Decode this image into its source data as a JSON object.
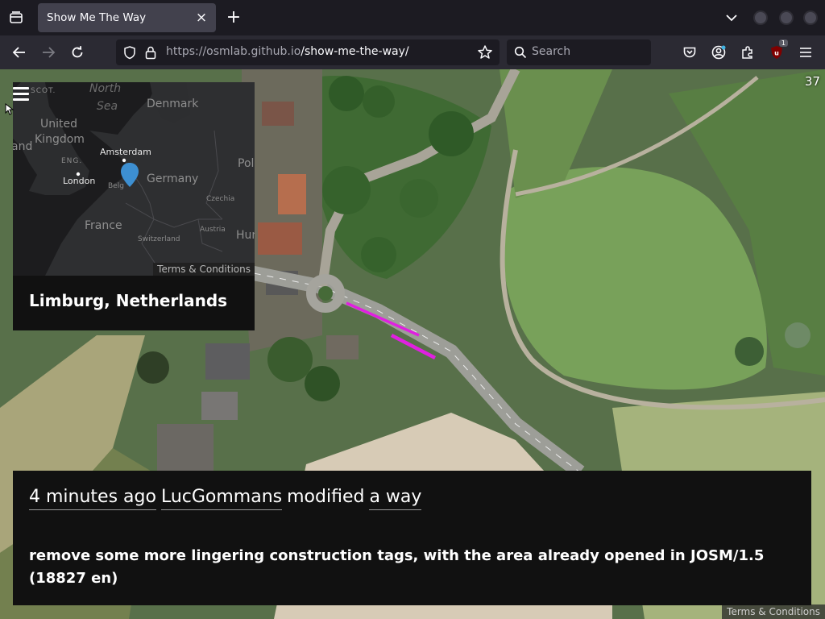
{
  "browser": {
    "tab_title": "Show Me The Way",
    "tab_close": "×",
    "new_tab": "+",
    "url_host": "https://osmlab.github.io",
    "url_path": "/show-me-the-way/",
    "search_placeholder": "Search",
    "extension_badge": "1"
  },
  "map": {
    "counter": "37",
    "attribution": "Terms & Conditions"
  },
  "inset": {
    "location": "Limburg, Netherlands",
    "attribution": "Terms & Conditions",
    "labels": {
      "north_sea_1": "North",
      "north_sea_2": "Sea",
      "denmark": "Denmark",
      "uk_1": "United",
      "uk_2": "Kingdom",
      "ireland_partial": "and",
      "scot": "SCOT.",
      "eng": "ENG.",
      "amsterdam": "Amsterdam",
      "london": "London",
      "germany": "Germany",
      "poland_partial": "Pol",
      "czechia": "Czechia",
      "france": "France",
      "austria": "Austria",
      "switzerland": "Switzerland",
      "hungary_partial": "Hun",
      "belgium_partial": "Belg"
    }
  },
  "changeset": {
    "time": "4 minutes ago",
    "user": "LucGommans",
    "verb": "modified",
    "object": "a way",
    "comment": "remove some more lingering construction tags, with the area already opened in JOSM/1.5 (18827 en)"
  },
  "colors": {
    "accent_marker": "#3d8fd1",
    "highlight_way": "#e020e0",
    "panel_bg": "#111111"
  }
}
